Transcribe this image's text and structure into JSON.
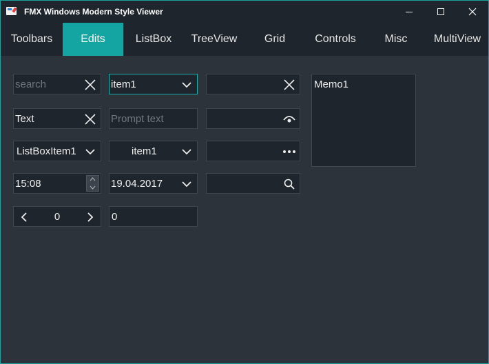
{
  "window": {
    "title": "FMX Windows Modern Style Viewer"
  },
  "tabs": [
    {
      "label": "Toolbars"
    },
    {
      "label": "Edits"
    },
    {
      "label": "ListBox"
    },
    {
      "label": "TreeView"
    },
    {
      "label": "Grid"
    },
    {
      "label": "Controls"
    },
    {
      "label": "Misc"
    },
    {
      "label": "MultiView"
    }
  ],
  "active_tab": "Edits",
  "edits": {
    "search": {
      "placeholder": "search",
      "value": ""
    },
    "combo_edit": {
      "value": "item1"
    },
    "clear_edit": {
      "value": ""
    },
    "text_edit": {
      "value": "Text"
    },
    "prompt_edit": {
      "placeholder": "Prompt text",
      "value": ""
    },
    "password_edit": {
      "value": ""
    },
    "listbox_combo": {
      "value": "ListBoxItem1"
    },
    "combo_box": {
      "value": "item1"
    },
    "ellipsis_edit": {
      "value": ""
    },
    "time_edit": {
      "value": "15:08"
    },
    "date_edit": {
      "value": "19.04.2017"
    },
    "search_edit": {
      "value": ""
    },
    "spin_box": {
      "value": "0"
    },
    "number_edit": {
      "value": "0"
    }
  },
  "memo": {
    "text": "Memo1"
  },
  "colors": {
    "accent": "#14a5a2",
    "background": "#2d333b",
    "field_bg": "#1f252c",
    "border": "#3e4650"
  },
  "icons": {
    "clear": "close-icon",
    "dropdown": "chevron-down-icon",
    "password": "eye-icon",
    "ellipsis": "ellipsis-icon",
    "search": "search-icon",
    "spin_left": "chevron-left-icon",
    "spin_right": "chevron-right-icon"
  }
}
